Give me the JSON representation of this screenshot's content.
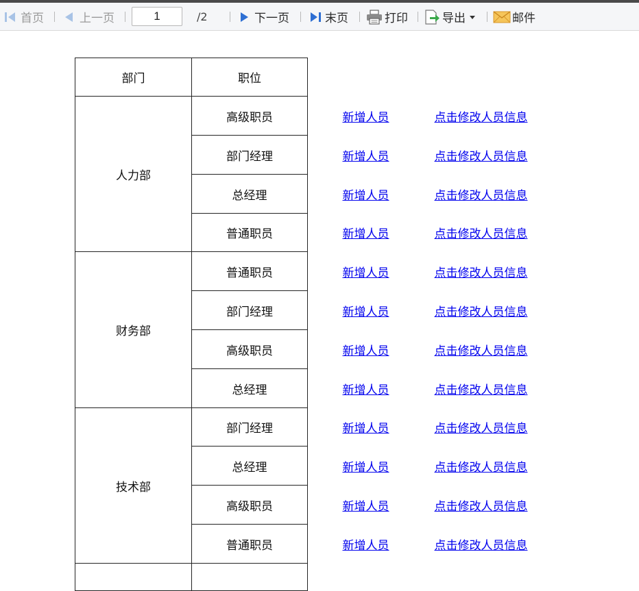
{
  "toolbar": {
    "first_page": "首页",
    "prev_page": "上一页",
    "page_value": "1",
    "page_total": "/2",
    "next_page": "下一页",
    "last_page": "末页",
    "print": "打印",
    "export": "导出",
    "mail": "邮件",
    "colors": {
      "disabled_icon": "#a8c3e6",
      "enabled_icon": "#2e6fd3",
      "export_icon": "#3aa84a",
      "mail_icon": "#f0b038"
    }
  },
  "table": {
    "headers": {
      "department": "部门",
      "position": "职位"
    },
    "link_labels": {
      "add": "新增人员",
      "edit": "点击修改人员信息"
    },
    "groups": [
      {
        "department": "人力部",
        "positions": [
          "高级职员",
          "部门经理",
          "总经理",
          "普通职员"
        ]
      },
      {
        "department": "财务部",
        "positions": [
          "普通职员",
          "部门经理",
          "高级职员",
          "总经理"
        ]
      },
      {
        "department": "技术部",
        "positions": [
          "部门经理",
          "总经理",
          "高级职员",
          "普通职员"
        ]
      }
    ]
  }
}
